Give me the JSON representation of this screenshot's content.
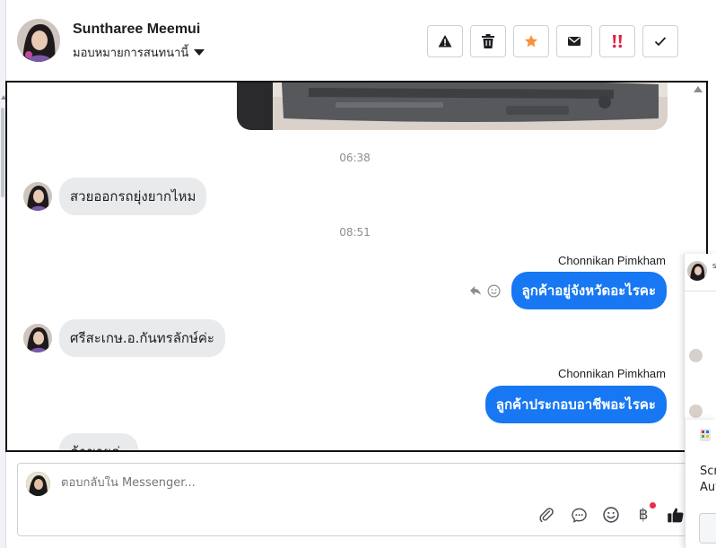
{
  "header": {
    "name": "Suntharee Meemui",
    "assign_label": "มอบหมายการสนทนานี้",
    "actions": [
      {
        "icon": "warning-icon",
        "color": "#1c1e21"
      },
      {
        "icon": "trash-icon",
        "color": "#1c1e21"
      },
      {
        "icon": "star-icon",
        "color": "#f7923a"
      },
      {
        "icon": "envelope-icon",
        "color": "#1c1e21"
      },
      {
        "icon": "double-exclamation-icon",
        "color": "#e41e3f"
      },
      {
        "icon": "check-icon",
        "color": "#1c1e21"
      }
    ]
  },
  "conversation": {
    "time_1": "06:38",
    "msg_in_1": "สวยออกรถยุ่งยากไหม",
    "time_2": "08:51",
    "sender_1": "Chonnikan Pimkham",
    "msg_out_1": "ลูกค้าอยู่จังหวัดอะไรคะ",
    "msg_in_2": "ศรีสะเกษ.อ.กันทรลักษ์ค่ะ",
    "sender_2": "Chonnikan Pimkham",
    "msg_out_2": "ลูกค้าประกอบอาชีพอะไรคะ",
    "msg_in_3": "ค้าขายค่ะ"
  },
  "composer": {
    "placeholder": "ตอบกลับใน Messenger...",
    "tools": [
      "paperclip-icon",
      "chat-bubble-icon",
      "smiley-icon",
      "baht-icon",
      "thumbs-up-icon"
    ],
    "baht_symbol": "฿"
  },
  "side_panel": {
    "header_text": "S"
  },
  "notification": {
    "line_1": "Scr",
    "line_2": "Aut"
  },
  "colors": {
    "accent": "#1877f2",
    "incoming_bubble": "#e9eaec",
    "notification_dot": "#f02849"
  }
}
